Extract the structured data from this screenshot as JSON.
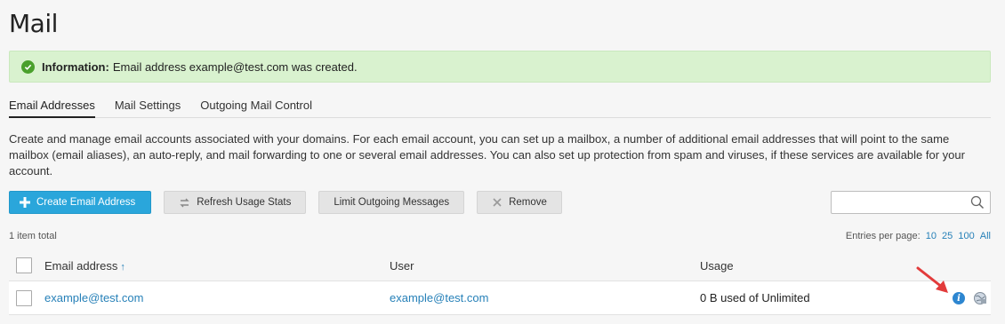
{
  "page": {
    "title": "Mail"
  },
  "message": {
    "label": "Information:",
    "text": "Email address example@test.com was created.",
    "color": "#d9f2cf",
    "icon": "check-circle-icon"
  },
  "tabs": [
    {
      "label": "Email Addresses",
      "active": true
    },
    {
      "label": "Mail Settings",
      "active": false
    },
    {
      "label": "Outgoing Mail Control",
      "active": false
    }
  ],
  "description": "Create and manage email accounts associated with your domains. For each email account, you can set up a mailbox, a number of additional email addresses that will point to the same mailbox (email aliases), an auto-reply, and mail forwarding to one or several email addresses. You can also set up protection from spam and viruses, if these services are available for your account.",
  "toolbar": {
    "create_label": "Create Email Address",
    "refresh_label": "Refresh Usage Stats",
    "limit_label": "Limit Outgoing Messages",
    "remove_label": "Remove",
    "accent": "#2aa6db"
  },
  "search": {
    "value": "",
    "placeholder": ""
  },
  "list": {
    "total": "1 item total",
    "per_page_label": "Entries per page:",
    "per_page_options": [
      "10",
      "25",
      "100",
      "All"
    ]
  },
  "table": {
    "columns": {
      "email": "Email address",
      "user": "User",
      "usage": "Usage"
    },
    "sort_indicator": "↑",
    "rows": [
      {
        "email": "example@test.com",
        "user": "example@test.com",
        "usage": "0 B used of Unlimited"
      }
    ]
  },
  "icons": {
    "info": "i",
    "webmail": "webmail-globe-icon",
    "annotation": "red-arrow"
  }
}
